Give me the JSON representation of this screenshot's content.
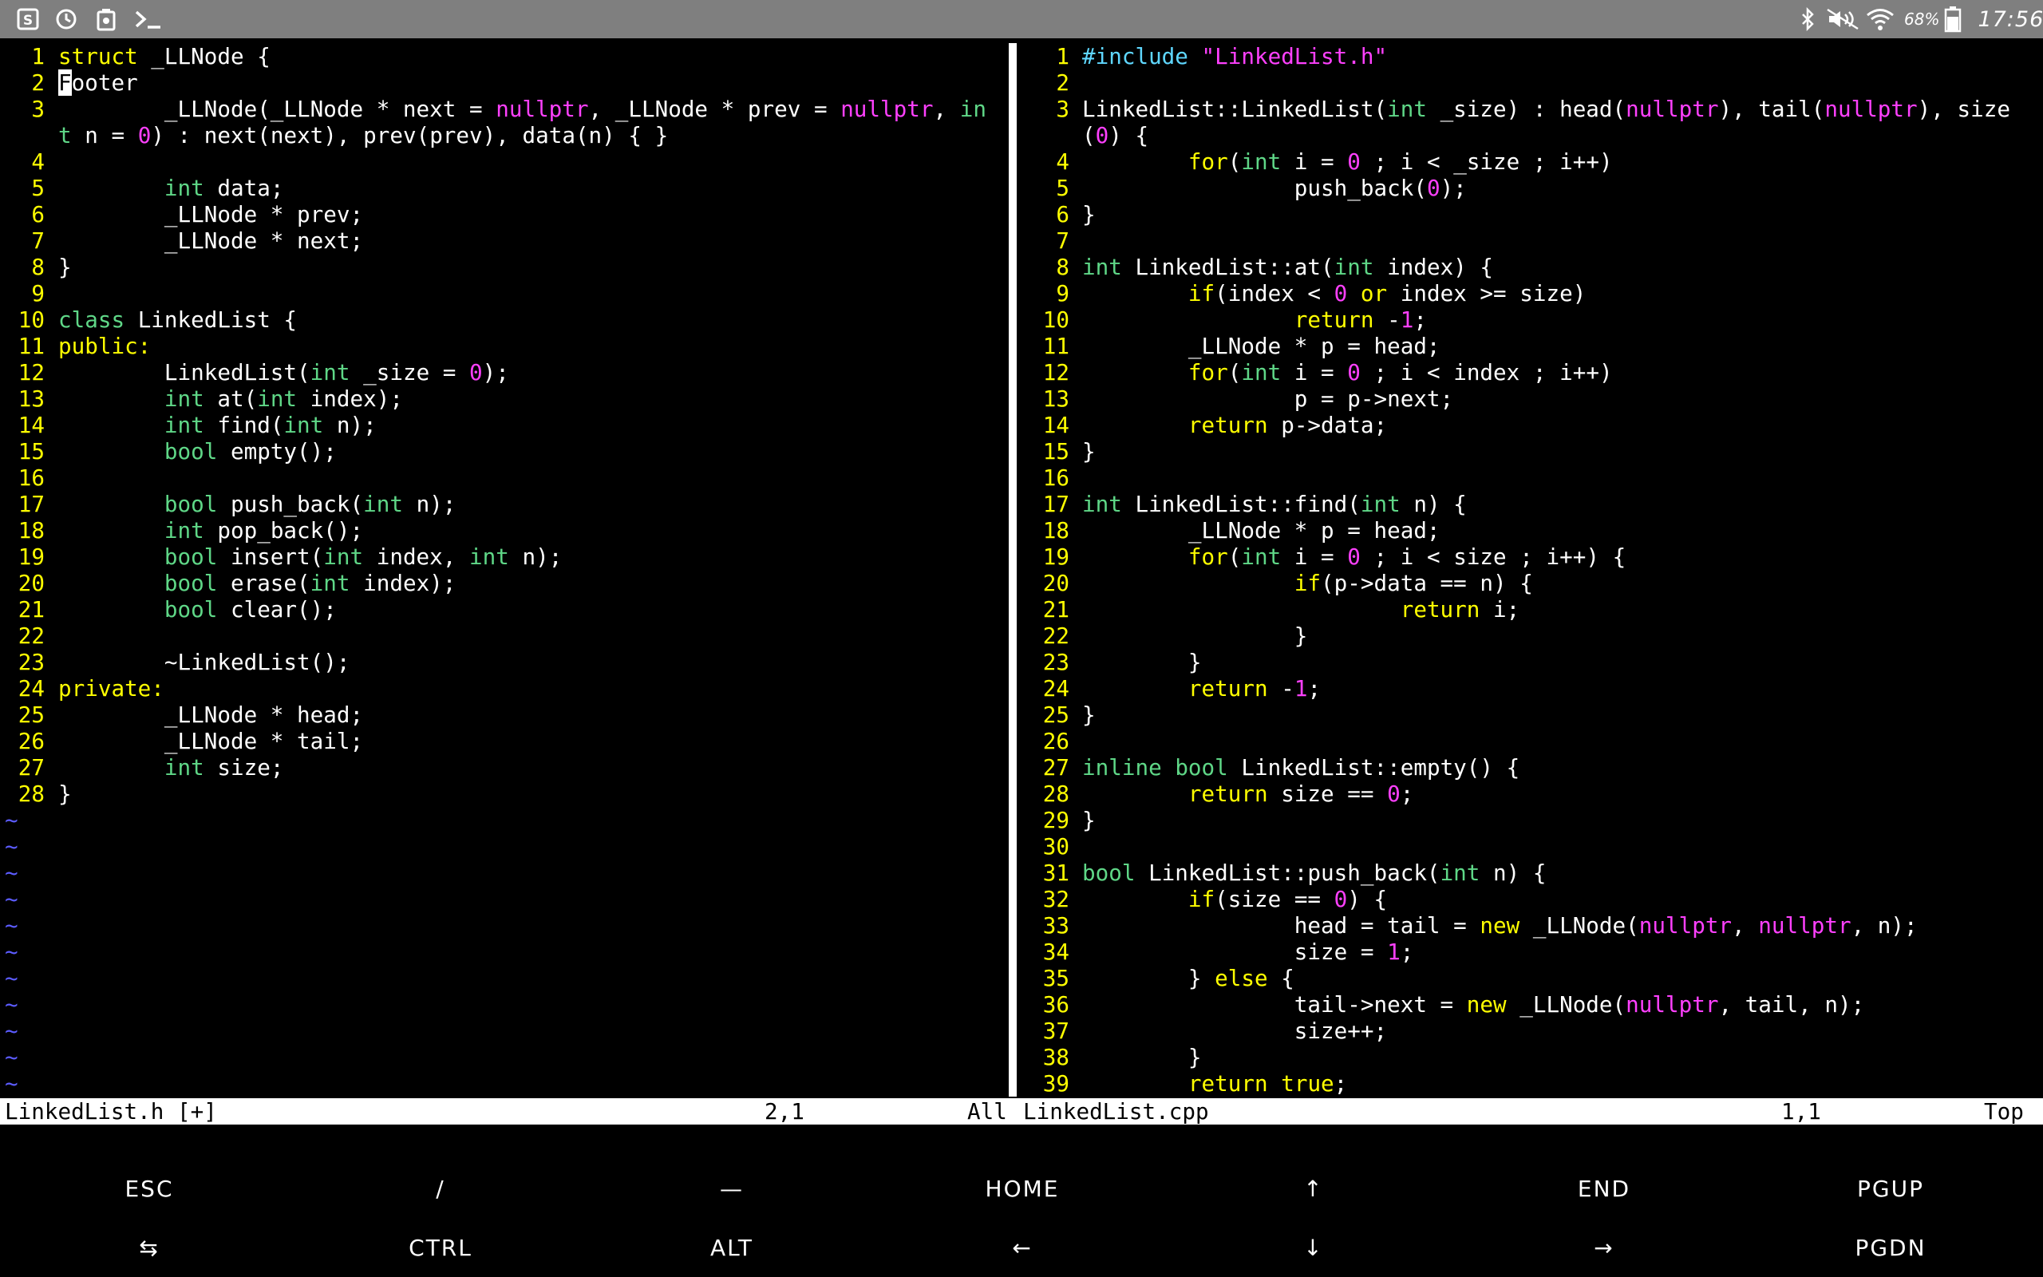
{
  "statusbar": {
    "left_icons": [
      "s-icon",
      "sync-icon",
      "recycle-icon",
      "terminal-icon"
    ],
    "right_icons": [
      "bluetooth-icon",
      "mute-icon",
      "wifi-icon",
      "battery-icon"
    ],
    "battery": "68%",
    "time": "17:56"
  },
  "left_pane": {
    "lines": [
      {
        "n": "1",
        "t": [
          [
            "struct",
            "kw"
          ],
          [
            " _LLNode {",
            ""
          ]
        ]
      },
      {
        "n": "2",
        "t": [
          [
            "F",
            "cursor"
          ],
          [
            "ooter",
            ""
          ]
        ]
      },
      {
        "n": "3",
        "t": [
          [
            "        _LLNode(_LLNode * next = ",
            ""
          ],
          [
            "nullptr",
            "co"
          ],
          [
            ", _LLNode * prev = ",
            ""
          ],
          [
            "nullptr",
            "co"
          ],
          [
            ", ",
            ""
          ],
          [
            "in",
            "ty"
          ]
        ]
      },
      {
        "n": "",
        "t": [
          [
            "t",
            "ty"
          ],
          [
            " n = ",
            ""
          ],
          [
            "0",
            "co"
          ],
          [
            ") : next(next), prev(prev), data(n) { }",
            ""
          ]
        ]
      },
      {
        "n": "4",
        "t": []
      },
      {
        "n": "5",
        "t": [
          [
            "        ",
            ""
          ],
          [
            "int",
            "ty"
          ],
          [
            " data;",
            ""
          ]
        ]
      },
      {
        "n": "6",
        "t": [
          [
            "        _LLNode * prev;",
            ""
          ]
        ]
      },
      {
        "n": "7",
        "t": [
          [
            "        _LLNode * next;",
            ""
          ]
        ]
      },
      {
        "n": "8",
        "t": [
          [
            "}",
            ""
          ]
        ]
      },
      {
        "n": "9",
        "t": []
      },
      {
        "n": "10",
        "t": [
          [
            "class",
            "ty"
          ],
          [
            " LinkedList {",
            ""
          ]
        ]
      },
      {
        "n": "11",
        "t": [
          [
            "public:",
            "kw"
          ]
        ]
      },
      {
        "n": "12",
        "t": [
          [
            "        LinkedList(",
            ""
          ],
          [
            "int",
            "ty"
          ],
          [
            " _size = ",
            ""
          ],
          [
            "0",
            "co"
          ],
          [
            ");",
            ""
          ]
        ]
      },
      {
        "n": "13",
        "t": [
          [
            "        ",
            ""
          ],
          [
            "int",
            "ty"
          ],
          [
            " at(",
            ""
          ],
          [
            "int",
            "ty"
          ],
          [
            " index);",
            ""
          ]
        ]
      },
      {
        "n": "14",
        "t": [
          [
            "        ",
            ""
          ],
          [
            "int",
            "ty"
          ],
          [
            " find(",
            ""
          ],
          [
            "int",
            "ty"
          ],
          [
            " n);",
            ""
          ]
        ]
      },
      {
        "n": "15",
        "t": [
          [
            "        ",
            ""
          ],
          [
            "bool",
            "ty"
          ],
          [
            " empty();",
            ""
          ]
        ]
      },
      {
        "n": "16",
        "t": []
      },
      {
        "n": "17",
        "t": [
          [
            "        ",
            ""
          ],
          [
            "bool",
            "ty"
          ],
          [
            " push_back(",
            ""
          ],
          [
            "int",
            "ty"
          ],
          [
            " n);",
            ""
          ]
        ]
      },
      {
        "n": "18",
        "t": [
          [
            "        ",
            ""
          ],
          [
            "int",
            "ty"
          ],
          [
            " pop_back();",
            ""
          ]
        ]
      },
      {
        "n": "19",
        "t": [
          [
            "        ",
            ""
          ],
          [
            "bool",
            "ty"
          ],
          [
            " insert(",
            ""
          ],
          [
            "int",
            "ty"
          ],
          [
            " index, ",
            ""
          ],
          [
            "int",
            "ty"
          ],
          [
            " n);",
            ""
          ]
        ]
      },
      {
        "n": "20",
        "t": [
          [
            "        ",
            ""
          ],
          [
            "bool",
            "ty"
          ],
          [
            " erase(",
            ""
          ],
          [
            "int",
            "ty"
          ],
          [
            " index);",
            ""
          ]
        ]
      },
      {
        "n": "21",
        "t": [
          [
            "        ",
            ""
          ],
          [
            "bool",
            "ty"
          ],
          [
            " clear();",
            ""
          ]
        ]
      },
      {
        "n": "22",
        "t": []
      },
      {
        "n": "23",
        "t": [
          [
            "        ~LinkedList();",
            ""
          ]
        ]
      },
      {
        "n": "24",
        "t": [
          [
            "private:",
            "kw"
          ]
        ]
      },
      {
        "n": "25",
        "t": [
          [
            "        _LLNode * head;",
            ""
          ]
        ]
      },
      {
        "n": "26",
        "t": [
          [
            "        _LLNode * tail;",
            ""
          ]
        ]
      },
      {
        "n": "27",
        "t": [
          [
            "        ",
            ""
          ],
          [
            "int",
            "ty"
          ],
          [
            " size;",
            ""
          ]
        ]
      },
      {
        "n": "28",
        "t": [
          [
            "}",
            ""
          ]
        ]
      }
    ],
    "tilde_count": 11,
    "status": {
      "filename": "LinkedList.h [+]",
      "position": "2,1",
      "scroll": "All"
    }
  },
  "right_pane": {
    "lines": [
      {
        "n": "1",
        "t": [
          [
            "#include ",
            "pp"
          ],
          [
            "\"LinkedList.h\"",
            "co"
          ]
        ]
      },
      {
        "n": "2",
        "t": []
      },
      {
        "n": "3",
        "t": [
          [
            "LinkedList::LinkedList(",
            ""
          ],
          [
            "int",
            "ty"
          ],
          [
            " _size) : head(",
            ""
          ],
          [
            "nullptr",
            "co"
          ],
          [
            "), tail(",
            ""
          ],
          [
            "nullptr",
            "co"
          ],
          [
            "), size",
            ""
          ]
        ]
      },
      {
        "n": "",
        "t": [
          [
            "(",
            ""
          ],
          [
            "0",
            "co"
          ],
          [
            ") {",
            ""
          ]
        ]
      },
      {
        "n": "4",
        "t": [
          [
            "        ",
            ""
          ],
          [
            "for",
            "kw"
          ],
          [
            "(",
            ""
          ],
          [
            "int",
            "ty"
          ],
          [
            " i = ",
            ""
          ],
          [
            "0",
            "co"
          ],
          [
            " ; i < _size ; i++)",
            ""
          ]
        ]
      },
      {
        "n": "5",
        "t": [
          [
            "                push_back(",
            ""
          ],
          [
            "0",
            "co"
          ],
          [
            ");",
            ""
          ]
        ]
      },
      {
        "n": "6",
        "t": [
          [
            "}",
            ""
          ]
        ]
      },
      {
        "n": "7",
        "t": []
      },
      {
        "n": "8",
        "t": [
          [
            "int",
            "ty"
          ],
          [
            " LinkedList::at(",
            ""
          ],
          [
            "int",
            "ty"
          ],
          [
            " index) {",
            ""
          ]
        ]
      },
      {
        "n": "9",
        "t": [
          [
            "        ",
            ""
          ],
          [
            "if",
            "kw"
          ],
          [
            "(index < ",
            ""
          ],
          [
            "0",
            "co"
          ],
          [
            " ",
            ""
          ],
          [
            "or",
            "kw"
          ],
          [
            " index >= size)",
            ""
          ]
        ]
      },
      {
        "n": "10",
        "t": [
          [
            "                ",
            ""
          ],
          [
            "return",
            "kw"
          ],
          [
            " -",
            ""
          ],
          [
            "1",
            "co"
          ],
          [
            ";",
            ""
          ]
        ]
      },
      {
        "n": "11",
        "t": [
          [
            "        _LLNode * p = head;",
            ""
          ]
        ]
      },
      {
        "n": "12",
        "t": [
          [
            "        ",
            ""
          ],
          [
            "for",
            "kw"
          ],
          [
            "(",
            ""
          ],
          [
            "int",
            "ty"
          ],
          [
            " i = ",
            ""
          ],
          [
            "0",
            "co"
          ],
          [
            " ; i < index ; i++)",
            ""
          ]
        ]
      },
      {
        "n": "13",
        "t": [
          [
            "                p = p->next;",
            ""
          ]
        ]
      },
      {
        "n": "14",
        "t": [
          [
            "        ",
            ""
          ],
          [
            "return",
            "kw"
          ],
          [
            " p->data;",
            ""
          ]
        ]
      },
      {
        "n": "15",
        "t": [
          [
            "}",
            ""
          ]
        ]
      },
      {
        "n": "16",
        "t": []
      },
      {
        "n": "17",
        "t": [
          [
            "int",
            "ty"
          ],
          [
            " LinkedList::find(",
            ""
          ],
          [
            "int",
            "ty"
          ],
          [
            " n) {",
            ""
          ]
        ]
      },
      {
        "n": "18",
        "t": [
          [
            "        _LLNode * p = head;",
            ""
          ]
        ]
      },
      {
        "n": "19",
        "t": [
          [
            "        ",
            ""
          ],
          [
            "for",
            "kw"
          ],
          [
            "(",
            ""
          ],
          [
            "int",
            "ty"
          ],
          [
            " i = ",
            ""
          ],
          [
            "0",
            "co"
          ],
          [
            " ; i < size ; i++) {",
            ""
          ]
        ]
      },
      {
        "n": "20",
        "t": [
          [
            "                ",
            ""
          ],
          [
            "if",
            "kw"
          ],
          [
            "(p->data == n) {",
            ""
          ]
        ]
      },
      {
        "n": "21",
        "t": [
          [
            "                        ",
            ""
          ],
          [
            "return",
            "kw"
          ],
          [
            " i;",
            ""
          ]
        ]
      },
      {
        "n": "22",
        "t": [
          [
            "                }",
            ""
          ]
        ]
      },
      {
        "n": "23",
        "t": [
          [
            "        }",
            ""
          ]
        ]
      },
      {
        "n": "24",
        "t": [
          [
            "        ",
            ""
          ],
          [
            "return",
            "kw"
          ],
          [
            " -",
            ""
          ],
          [
            "1",
            "co"
          ],
          [
            ";",
            ""
          ]
        ]
      },
      {
        "n": "25",
        "t": [
          [
            "}",
            ""
          ]
        ]
      },
      {
        "n": "26",
        "t": []
      },
      {
        "n": "27",
        "t": [
          [
            "inline",
            "ty"
          ],
          [
            " ",
            ""
          ],
          [
            "bool",
            "ty"
          ],
          [
            " LinkedList::empty() {",
            ""
          ]
        ]
      },
      {
        "n": "28",
        "t": [
          [
            "        ",
            ""
          ],
          [
            "return",
            "kw"
          ],
          [
            " size == ",
            ""
          ],
          [
            "0",
            "co"
          ],
          [
            ";",
            ""
          ]
        ]
      },
      {
        "n": "29",
        "t": [
          [
            "}",
            ""
          ]
        ]
      },
      {
        "n": "30",
        "t": []
      },
      {
        "n": "31",
        "t": [
          [
            "bool",
            "ty"
          ],
          [
            " LinkedList::push_back(",
            ""
          ],
          [
            "int",
            "ty"
          ],
          [
            " n) {",
            ""
          ]
        ]
      },
      {
        "n": "32",
        "t": [
          [
            "        ",
            ""
          ],
          [
            "if",
            "kw"
          ],
          [
            "(size == ",
            ""
          ],
          [
            "0",
            "co"
          ],
          [
            ") {",
            ""
          ]
        ]
      },
      {
        "n": "33",
        "t": [
          [
            "                head = tail = ",
            ""
          ],
          [
            "new",
            "kw"
          ],
          [
            " _LLNode(",
            ""
          ],
          [
            "nullptr",
            "co"
          ],
          [
            ", ",
            ""
          ],
          [
            "nullptr",
            "co"
          ],
          [
            ", n);",
            ""
          ]
        ]
      },
      {
        "n": "34",
        "t": [
          [
            "                size = ",
            ""
          ],
          [
            "1",
            "co"
          ],
          [
            ";",
            ""
          ]
        ]
      },
      {
        "n": "35",
        "t": [
          [
            "        } ",
            ""
          ],
          [
            "else",
            "kw"
          ],
          [
            " {",
            ""
          ]
        ]
      },
      {
        "n": "36",
        "t": [
          [
            "                tail->next = ",
            ""
          ],
          [
            "new",
            "kw"
          ],
          [
            " _LLNode(",
            ""
          ],
          [
            "nullptr",
            "co"
          ],
          [
            ", tail, n);",
            ""
          ]
        ]
      },
      {
        "n": "37",
        "t": [
          [
            "                size++;",
            ""
          ]
        ]
      },
      {
        "n": "38",
        "t": [
          [
            "        }",
            ""
          ]
        ]
      },
      {
        "n": "39",
        "t": [
          [
            "        ",
            ""
          ],
          [
            "return",
            "kw"
          ],
          [
            " ",
            ""
          ],
          [
            "true",
            "kw"
          ],
          [
            ";",
            ""
          ]
        ]
      }
    ],
    "status": {
      "filename": "LinkedList.cpp",
      "position": "1,1",
      "scroll": "Top"
    }
  },
  "extra_keys": {
    "row1": [
      "ESC",
      "/",
      "—",
      "HOME",
      "↑",
      "END",
      "PGUP"
    ],
    "row2": [
      "⇆",
      "CTRL",
      "ALT",
      "←",
      "↓",
      "→",
      "PGDN"
    ]
  },
  "colors": {
    "keyword": "#ffff00",
    "type": "#5fd787",
    "constant": "#ff40ff",
    "preproc": "#5fd7ff",
    "line_number": "#ffff00",
    "tilde": "#5c5cff",
    "statusbar_bg": "#7f7f7f"
  }
}
